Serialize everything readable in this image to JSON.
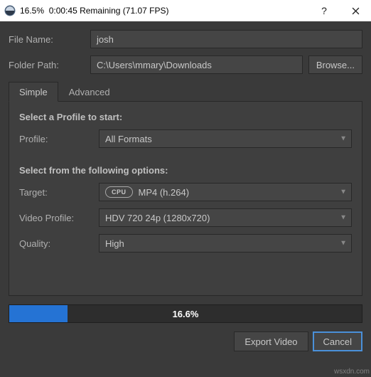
{
  "titlebar": {
    "percent": "16.5%",
    "remaining": "0:00:45 Remaining",
    "fps": "(71.07 FPS)"
  },
  "file": {
    "name_label": "File Name:",
    "name_value": "josh",
    "path_label": "Folder Path:",
    "path_value": "C:\\Users\\mmary\\Downloads",
    "browse_label": "Browse..."
  },
  "tabs": {
    "simple": "Simple",
    "advanced": "Advanced"
  },
  "panel": {
    "section1_title": "Select a Profile to start:",
    "profile_label": "Profile:",
    "profile_value": "All Formats",
    "section2_title": "Select from the following options:",
    "target_label": "Target:",
    "cpu_chip": "CPU",
    "target_value": "MP4 (h.264)",
    "vprofile_label": "Video Profile:",
    "vprofile_value": "HDV 720 24p (1280x720)",
    "quality_label": "Quality:",
    "quality_value": "High"
  },
  "progress": {
    "percent_text": "16.6%",
    "fill_width": "16.6%"
  },
  "footer": {
    "export_label": "Export Video",
    "cancel_label": "Cancel"
  },
  "watermark": "wsxdn.com"
}
